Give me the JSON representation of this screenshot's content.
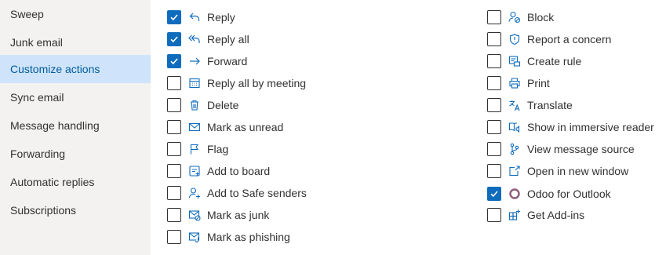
{
  "sidebar": {
    "items": [
      {
        "label": "Sweep"
      },
      {
        "label": "Junk email"
      },
      {
        "label": "Customize actions",
        "selected": true
      },
      {
        "label": "Sync email"
      },
      {
        "label": "Message handling"
      },
      {
        "label": "Forwarding"
      },
      {
        "label": "Automatic replies"
      },
      {
        "label": "Subscriptions"
      }
    ]
  },
  "actions": {
    "left": [
      {
        "label": "Reply",
        "checked": true,
        "icon": "reply-icon"
      },
      {
        "label": "Reply all",
        "checked": true,
        "icon": "reply-all-icon"
      },
      {
        "label": "Forward",
        "checked": true,
        "icon": "forward-icon"
      },
      {
        "label": "Reply all by meeting",
        "checked": false,
        "icon": "calendar-icon"
      },
      {
        "label": "Delete",
        "checked": false,
        "icon": "trash-icon"
      },
      {
        "label": "Mark as unread",
        "checked": false,
        "icon": "envelope-icon"
      },
      {
        "label": "Flag",
        "checked": false,
        "icon": "flag-icon"
      },
      {
        "label": "Add to board",
        "checked": false,
        "icon": "board-icon"
      },
      {
        "label": "Add to Safe senders",
        "checked": false,
        "icon": "person-add-icon"
      },
      {
        "label": "Mark as junk",
        "checked": false,
        "icon": "junk-icon"
      },
      {
        "label": "Mark as phishing",
        "checked": false,
        "icon": "phishing-icon"
      }
    ],
    "right": [
      {
        "label": "Block",
        "checked": false,
        "icon": "block-person-icon"
      },
      {
        "label": "Report a concern",
        "checked": false,
        "icon": "shield-icon"
      },
      {
        "label": "Create rule",
        "checked": false,
        "icon": "rule-icon"
      },
      {
        "label": "Print",
        "checked": false,
        "icon": "printer-icon"
      },
      {
        "label": "Translate",
        "checked": false,
        "icon": "translate-icon"
      },
      {
        "label": "Show in immersive reader",
        "checked": false,
        "icon": "immersive-reader-icon"
      },
      {
        "label": "View message source",
        "checked": false,
        "icon": "branch-icon"
      },
      {
        "label": "Open in new window",
        "checked": false,
        "icon": "open-window-icon"
      },
      {
        "label": "Odoo for Outlook",
        "checked": true,
        "icon": "odoo-icon"
      },
      {
        "label": "Get Add-ins",
        "checked": false,
        "icon": "add-ins-icon"
      }
    ]
  },
  "colors": {
    "accent": "#0f6cbd",
    "selected_nav_bg": "#cfe4fa",
    "selected_nav_text": "#005a9e",
    "sidebar_bg": "#f3f2f1",
    "odoo": "#8f5b7e"
  }
}
